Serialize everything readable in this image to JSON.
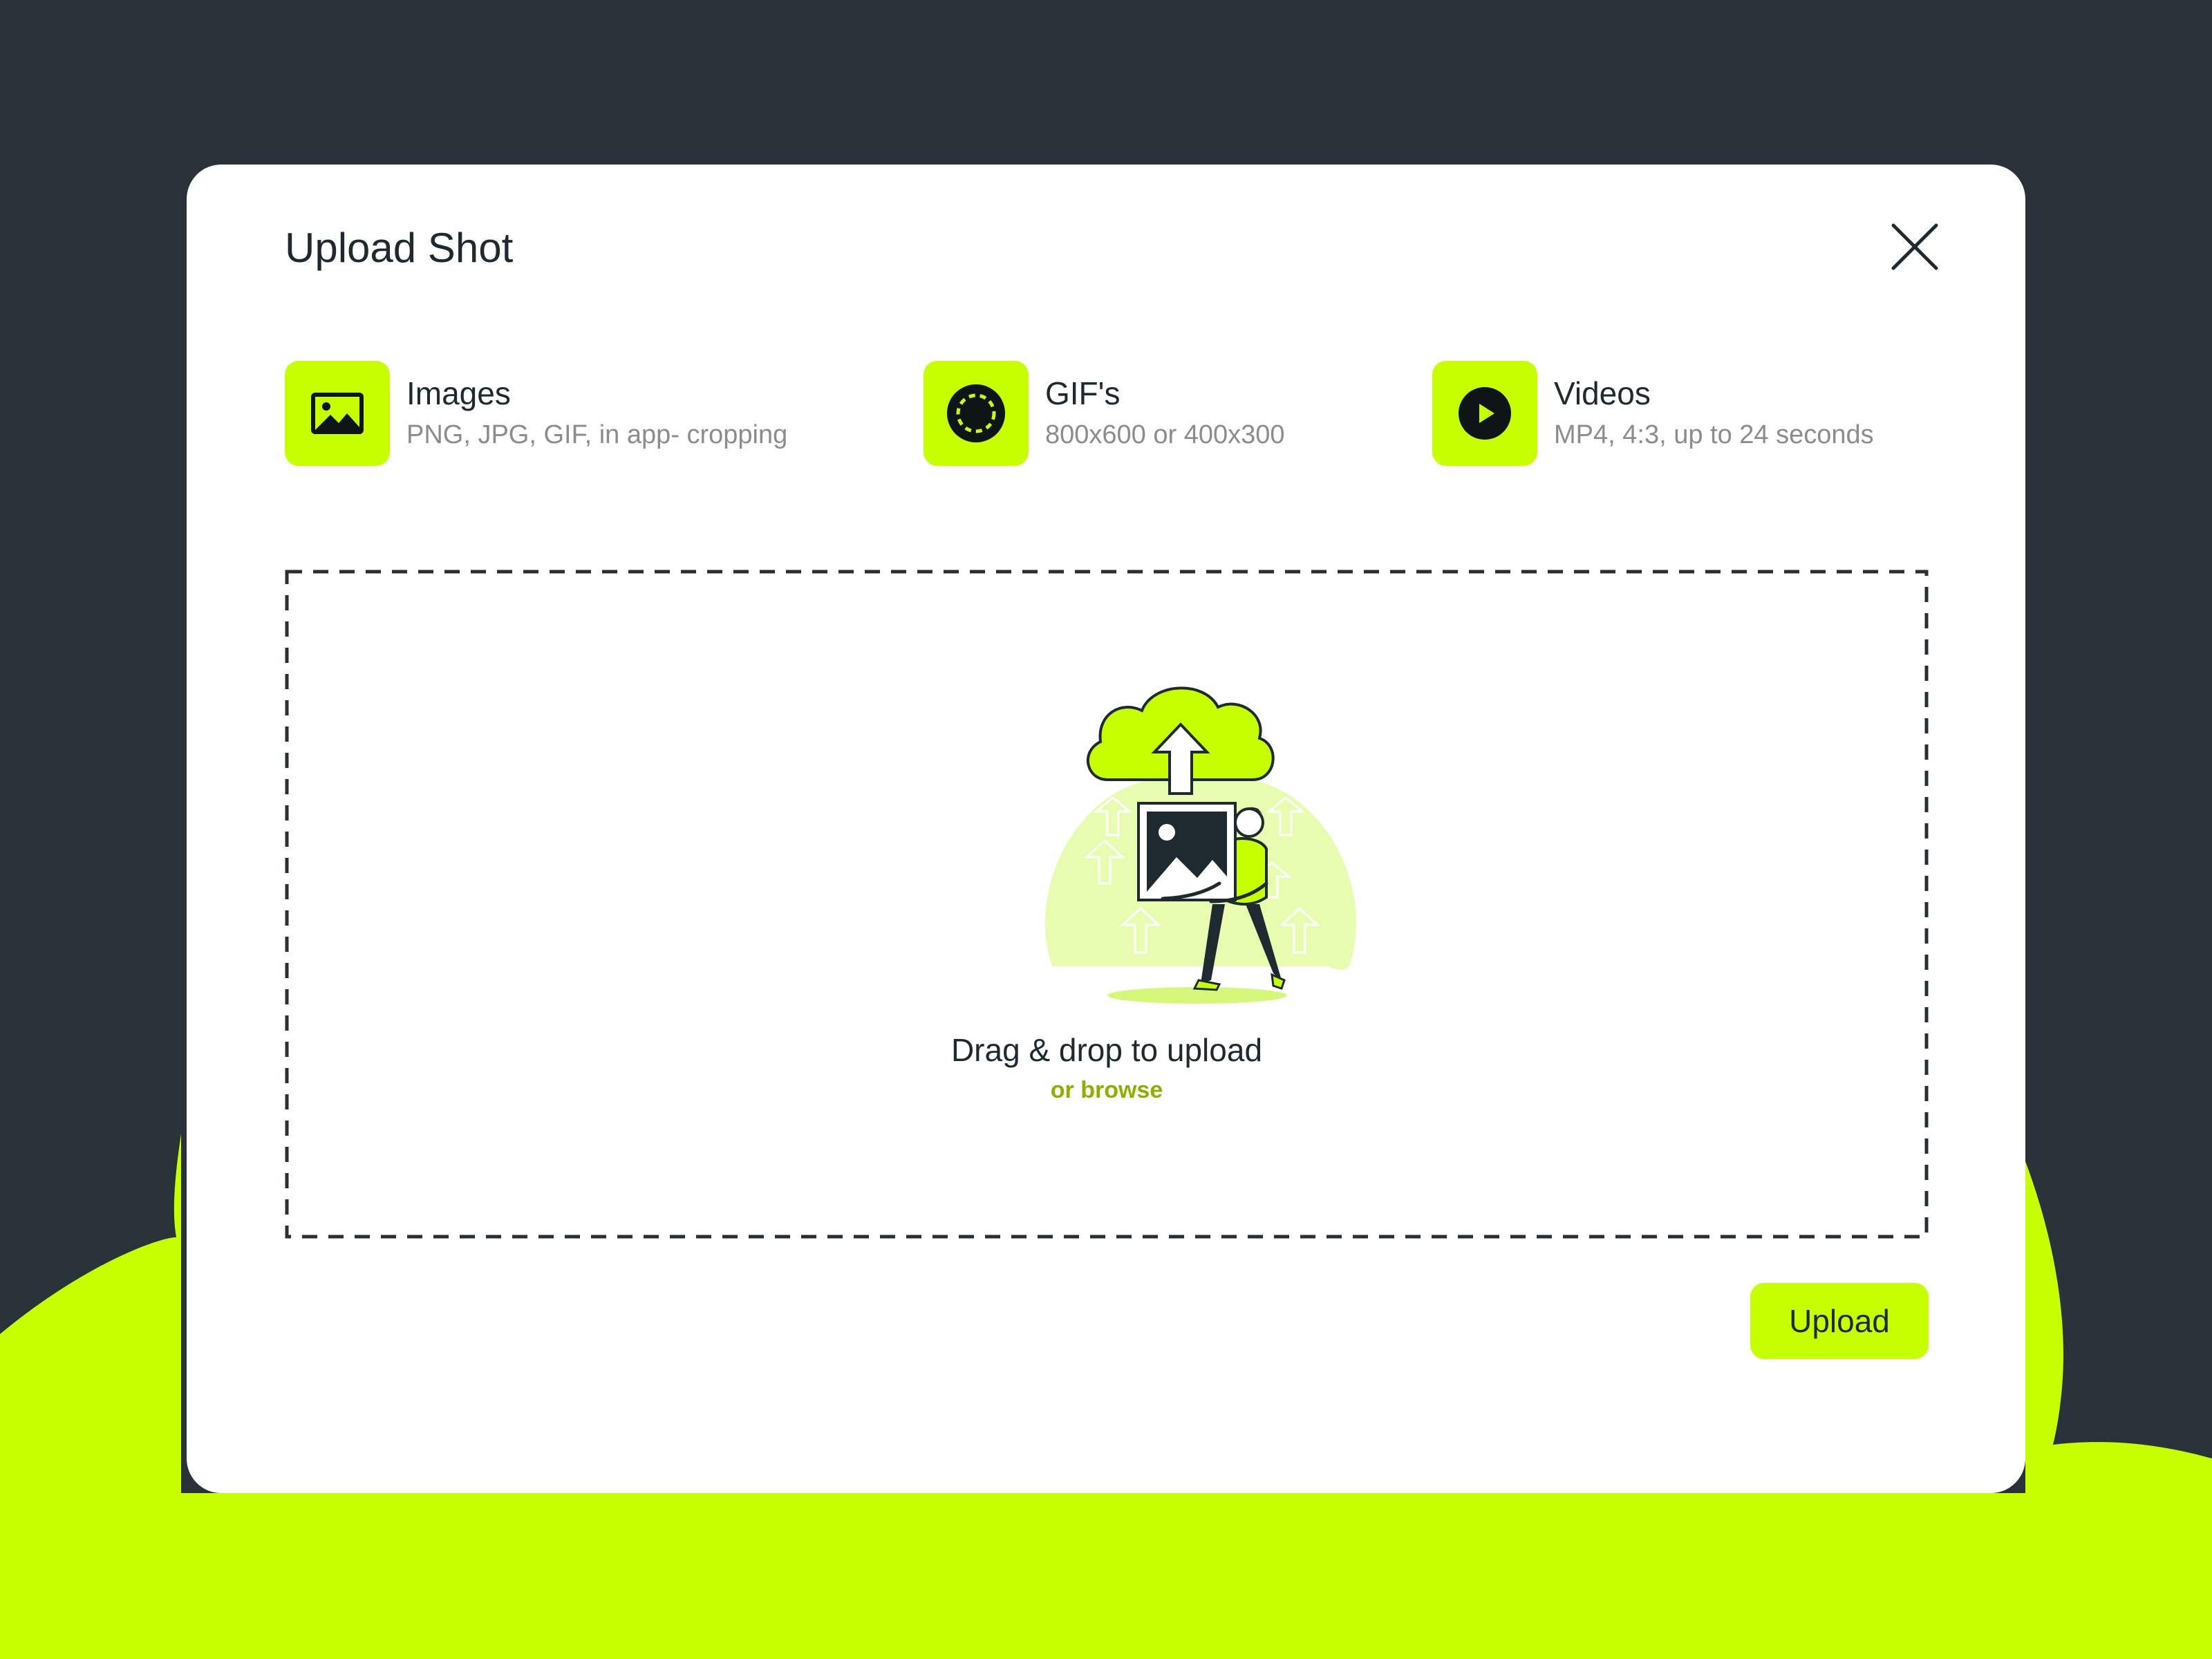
{
  "modal": {
    "title": "Upload Shot"
  },
  "file_types": [
    {
      "label": "Images",
      "description": "PNG, JPG, GIF, in app- cropping",
      "icon": "image-icon"
    },
    {
      "label": "GIF's",
      "description": "800x600 or 400x300",
      "icon": "gif-icon"
    },
    {
      "label": "Videos",
      "description": "MP4, 4:3, up to 24 seconds",
      "icon": "play-icon"
    }
  ],
  "dropzone": {
    "title": "Drag & drop to upload",
    "browse_label": "or browse"
  },
  "actions": {
    "upload_label": "Upload"
  },
  "colors": {
    "accent": "#c6ff00",
    "background": "#283238",
    "text": "#1f2a30",
    "muted": "#8c8c8c",
    "link": "#8db000"
  }
}
